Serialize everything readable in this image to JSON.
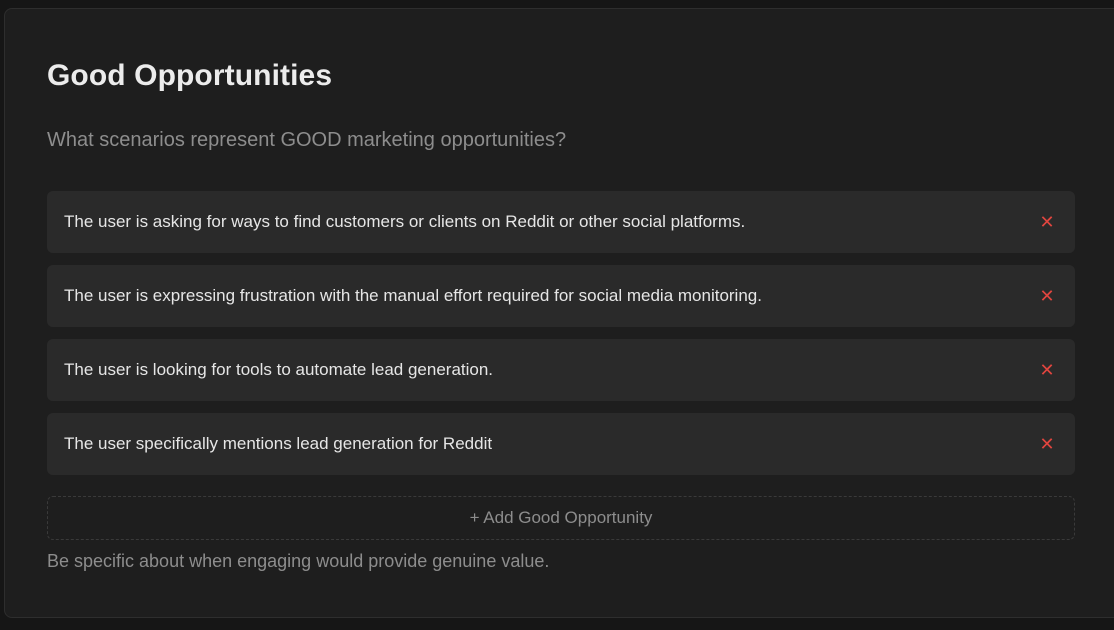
{
  "section": {
    "title": "Good Opportunities",
    "subtitle": "What scenarios represent GOOD marketing opportunities?",
    "items": [
      {
        "text": "The user is asking for ways to find customers or clients on Reddit or other social platforms.",
        "remove_glyph": "✕"
      },
      {
        "text": "The user is expressing frustration with the manual effort required for social media monitoring.",
        "remove_glyph": "✕"
      },
      {
        "text": "The user is looking for tools to automate lead generation.",
        "remove_glyph": "✕"
      },
      {
        "text": "The user specifically mentions lead generation for Reddit",
        "remove_glyph": "✕"
      }
    ],
    "add_label": "+ Add Good Opportunity",
    "hint": "Be specific about when engaging would provide genuine value."
  },
  "colors": {
    "background": "#1e1e1e",
    "item_background": "#2a2a2a",
    "remove_icon": "#e0453f",
    "muted_text": "#8d8d8d"
  }
}
